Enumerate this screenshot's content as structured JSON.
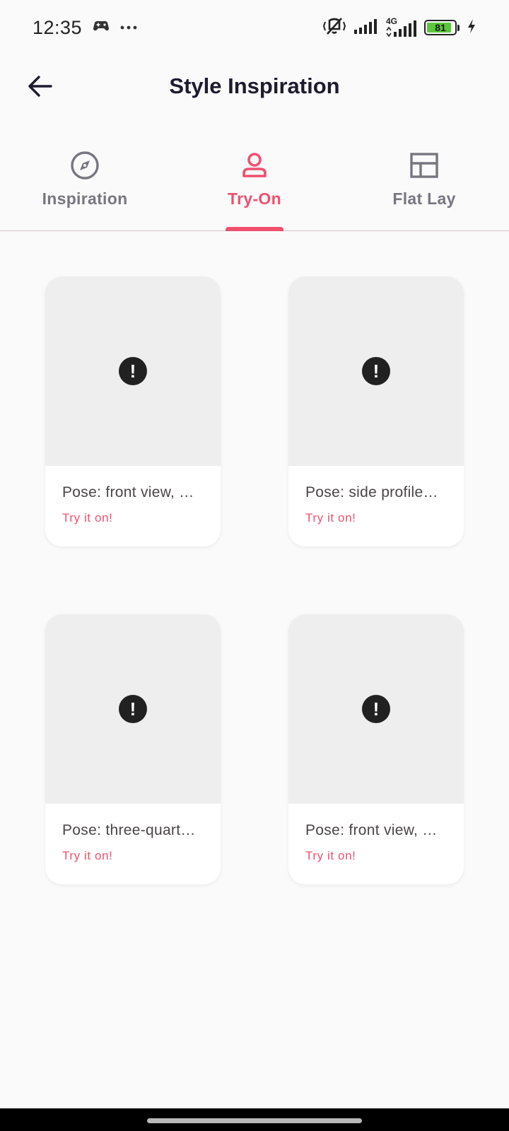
{
  "status_bar": {
    "time": "12:35",
    "battery": "81",
    "network": "4G",
    "icons": [
      "game-controller-icon",
      "more-dots-icon",
      "vibrate-off-icon",
      "signal-icon",
      "signal-4g-icon",
      "battery-icon",
      "charging-bolt-icon"
    ]
  },
  "app_bar": {
    "title": "Style Inspiration",
    "back_icon": "arrow-back-icon"
  },
  "tabs": [
    {
      "label": "Inspiration",
      "icon": "compass-icon",
      "active": false
    },
    {
      "label": "Try-On",
      "icon": "person-icon",
      "active": true
    },
    {
      "label": "Flat Lay",
      "icon": "layout-icon",
      "active": false
    }
  ],
  "colors": {
    "accent": "#f0506e",
    "inactive": "#777680",
    "image_placeholder": "#eeeeee"
  },
  "cards": [
    {
      "title": "Pose: front view, …",
      "action": "Try it on!",
      "image_icon": "error-icon"
    },
    {
      "title": "Pose: side profile…",
      "action": "Try it on!",
      "image_icon": "error-icon"
    },
    {
      "title": "Pose: three-quart…",
      "action": "Try it on!",
      "image_icon": "error-icon"
    },
    {
      "title": "Pose: front view, …",
      "action": "Try it on!",
      "image_icon": "error-icon"
    }
  ]
}
